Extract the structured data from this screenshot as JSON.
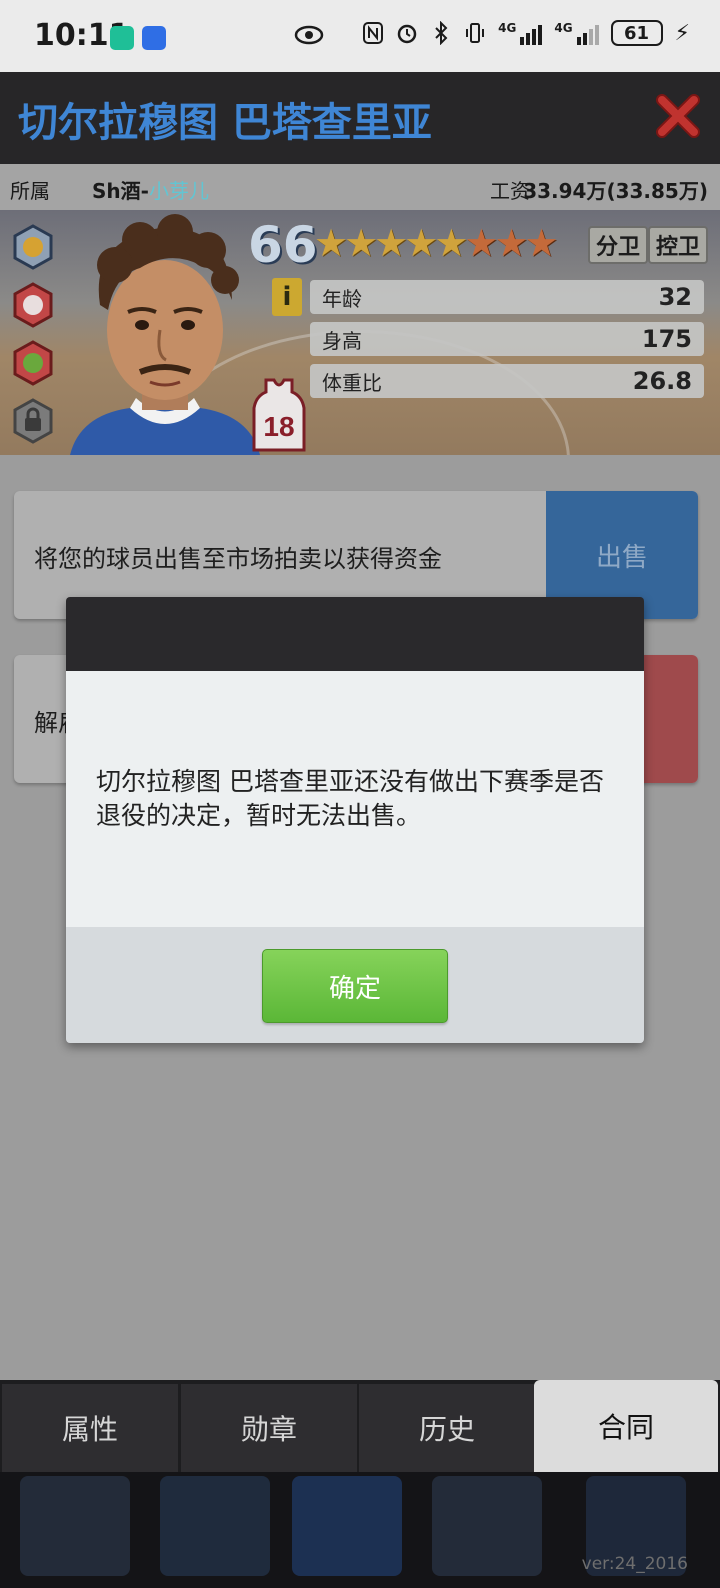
{
  "status_bar": {
    "time": "10:11",
    "net_label_1": "4G",
    "net_label_2": "4G",
    "battery": "61"
  },
  "header": {
    "title": "切尔拉穆图 巴塔查里亚",
    "close_icon": "close-x-icon"
  },
  "info_bar": {
    "owner_label": "所属",
    "owner_name": "Sh酒-",
    "owner_nick": "小芽儿",
    "salary_label": "工资",
    "salary_value": "33.94万(33.85万)"
  },
  "player": {
    "rating": "66",
    "stars_gold": 5,
    "stars_orange": 3,
    "positions": [
      "分卫",
      "控卫"
    ],
    "info_icon_text": "i",
    "stats": [
      {
        "label": "年龄",
        "value": "32"
      },
      {
        "label": "身高",
        "value": "175"
      },
      {
        "label": "体重比",
        "value": "26.8"
      }
    ],
    "jersey_number": "18"
  },
  "content": {
    "sell_text": "将您的球员出售至市场拍卖以获得资金",
    "sell_button": "出售",
    "release_text_partial": "解雇"
  },
  "dialog": {
    "message": "切尔拉穆图 巴塔查里亚还没有做出下赛季是否退役的决定，暂时无法出售。",
    "ok_button": "确定"
  },
  "tabs": [
    {
      "label": "属性",
      "active": false
    },
    {
      "label": "勋章",
      "active": false
    },
    {
      "label": "历史",
      "active": false
    },
    {
      "label": "合同",
      "active": true
    }
  ],
  "version": "ver:24_2016",
  "colors": {
    "title_blue": "#3f86d5",
    "close_red": "#c0332f",
    "sell_blue": "#35669a",
    "ok_green": "#5bb737"
  }
}
